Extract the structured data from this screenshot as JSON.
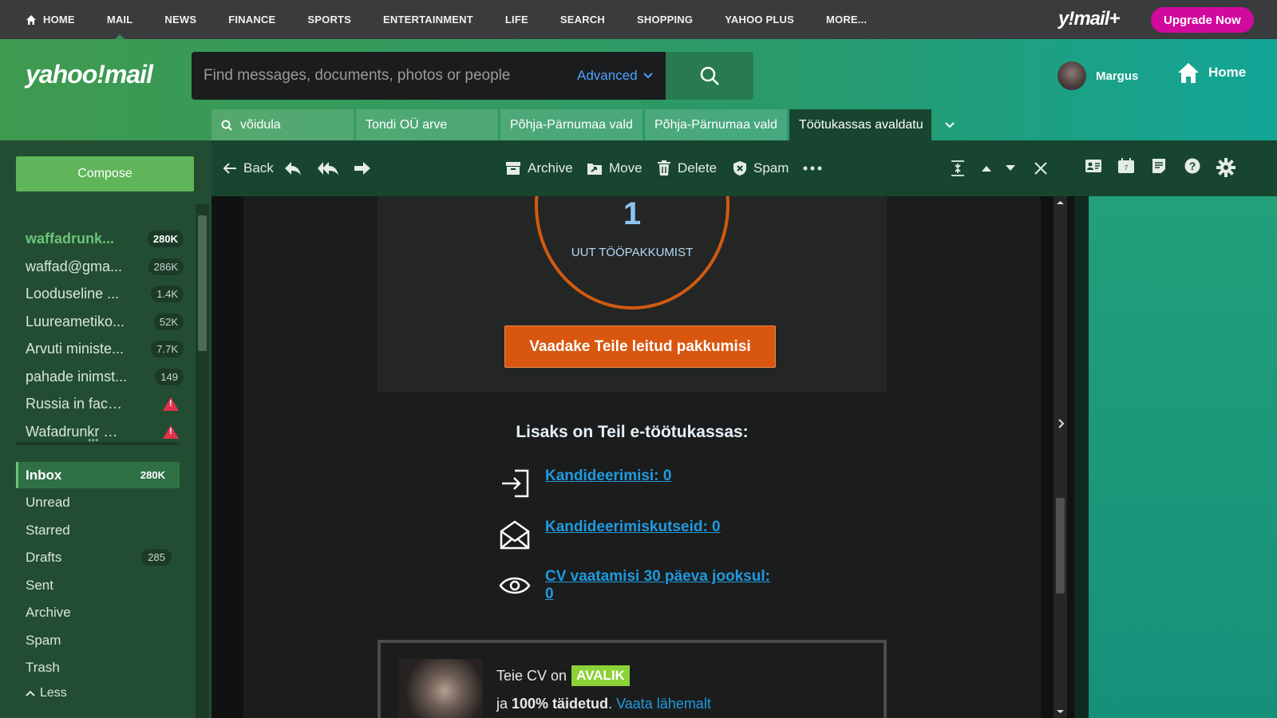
{
  "topnav": {
    "items": [
      "HOME",
      "MAIL",
      "NEWS",
      "FINANCE",
      "SPORTS",
      "ENTERTAINMENT",
      "LIFE",
      "SEARCH",
      "SHOPPING",
      "YAHOO PLUS",
      "MORE..."
    ],
    "brand": "y!mail+",
    "upgrade": "Upgrade Now"
  },
  "header": {
    "logo": "yahoo!mail",
    "search_placeholder": "Find messages, documents, photos or people",
    "advanced": "Advanced",
    "user": "Margus",
    "home": "Home"
  },
  "tabs": [
    "võidula",
    "Tondi OÜ arve",
    "Põhja-Pärnumaa vald",
    "Põhja-Pärnumaa vald",
    "Töötukassas avaldatu"
  ],
  "sidebar": {
    "compose": "Compose",
    "accounts": [
      {
        "name": "waffadrunk...",
        "count": "280K"
      },
      {
        "name": "waffad@gma...",
        "count": "286K"
      },
      {
        "name": "Looduseline ...",
        "count": "1.4K"
      },
      {
        "name": "Luureametiko...",
        "count": "52K"
      },
      {
        "name": "Arvuti ministe...",
        "count": "7.7K"
      },
      {
        "name": "pahade inimst...",
        "count": "149"
      },
      {
        "name": "Russia in faceb...",
        "count": ""
      },
      {
        "name": "Wafadrunkr wa...",
        "count": ""
      }
    ],
    "folders": [
      {
        "name": "Inbox",
        "count": "280K"
      },
      {
        "name": "Unread",
        "count": ""
      },
      {
        "name": "Starred",
        "count": ""
      },
      {
        "name": "Drafts",
        "count": "285"
      },
      {
        "name": "Sent",
        "count": ""
      },
      {
        "name": "Archive",
        "count": ""
      },
      {
        "name": "Spam",
        "count": ""
      },
      {
        "name": "Trash",
        "count": ""
      }
    ],
    "less": "Less"
  },
  "toolbar": {
    "back": "Back",
    "archive": "Archive",
    "move": "Move",
    "delete": "Delete",
    "spam": "Spam"
  },
  "email": {
    "count": "1",
    "count_label": "UUT TÖÖPAKKUMIST",
    "cta": "Vaadake Teile leitud pakkumisi",
    "heading": "Lisaks on Teil e-töötukassas:",
    "stats": [
      "Kandideerimisi: 0",
      "Kandideerimiskutseid: 0",
      "CV vaatamisi 30 päeva jooksul: 0"
    ],
    "cv_prefix": "Teie CV on",
    "cv_badge": "AVALIK",
    "cv_line2_a": "ja ",
    "cv_line2_b": "100% täidetud",
    "cv_line2_c": ". ",
    "cv_link": "Vaata lähemalt"
  }
}
